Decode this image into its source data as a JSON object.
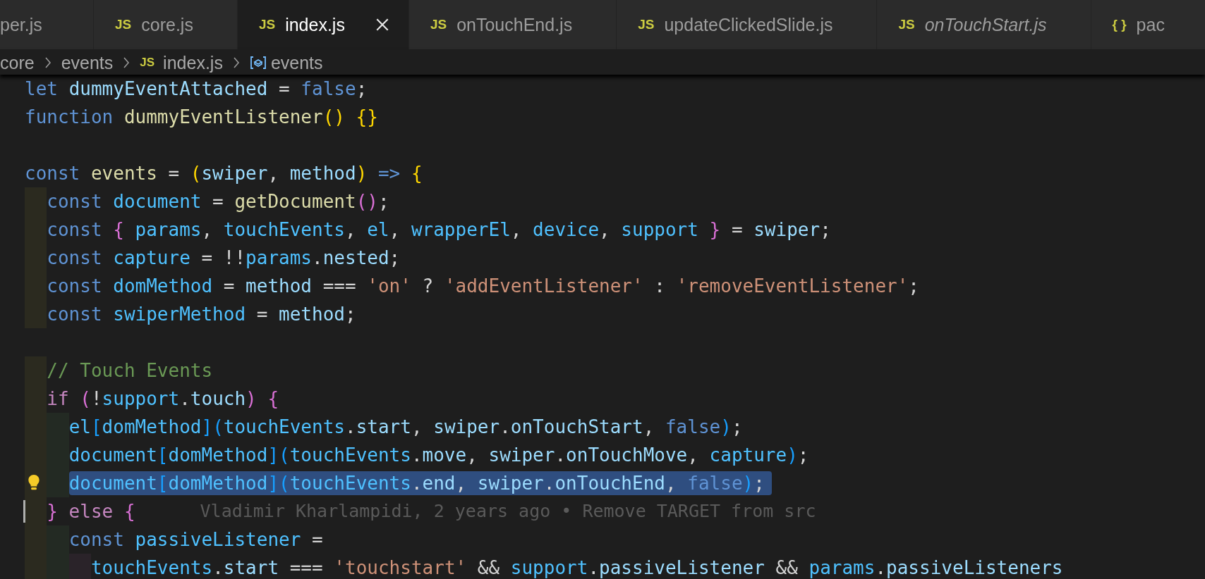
{
  "tabs": [
    {
      "label": "per.js",
      "selected": false,
      "preview": false
    },
    {
      "icon": "JS",
      "label": "core.js",
      "selected": false,
      "preview": false
    },
    {
      "icon": "JS",
      "label": "index.js",
      "selected": true,
      "preview": false
    },
    {
      "icon": "JS",
      "label": "onTouchEnd.js",
      "selected": false,
      "preview": false
    },
    {
      "icon": "JS",
      "label": "updateClickedSlide.js",
      "selected": false,
      "preview": false
    },
    {
      "icon": "JS",
      "label": "onTouchStart.js",
      "selected": false,
      "preview": true
    },
    {
      "icon": "{ }",
      "label": "pac",
      "selected": false,
      "preview": false
    }
  ],
  "breadcrumb": [
    {
      "kind": "folder",
      "label": "core"
    },
    {
      "kind": "folder",
      "label": "events"
    },
    {
      "kind": "file",
      "icon": "JS",
      "label": "index.js"
    },
    {
      "kind": "symbol",
      "label": "events"
    }
  ],
  "code_lines": [
    {
      "kind": "code",
      "tokens": [
        {
          "text": "let ",
          "kind": "keyword"
        },
        {
          "text": "dummyEventAttached",
          "kind": "param"
        },
        {
          "text": " = ",
          "kind": "plain"
        },
        {
          "text": "false",
          "kind": "keyword"
        },
        {
          "text": ";",
          "kind": "plain"
        }
      ]
    },
    {
      "kind": "code",
      "tokens": [
        {
          "text": "function ",
          "kind": "keyword"
        },
        {
          "text": "dummyEventListener",
          "kind": "function"
        },
        {
          "text": "() {}",
          "kind": "bracket1"
        }
      ]
    },
    {
      "kind": "blank"
    },
    {
      "kind": "code",
      "tokens": [
        {
          "text": "const ",
          "kind": "keyword"
        },
        {
          "text": "events",
          "kind": "function"
        },
        {
          "text": " = ",
          "kind": "plain"
        },
        {
          "text": "(",
          "kind": "bracket1"
        },
        {
          "text": "swiper",
          "kind": "param"
        },
        {
          "text": ", ",
          "kind": "plain"
        },
        {
          "text": "method",
          "kind": "param"
        },
        {
          "text": ")",
          "kind": "bracket1"
        },
        {
          "text": " => ",
          "kind": "keyword"
        },
        {
          "text": "{",
          "kind": "bracket1"
        }
      ]
    },
    {
      "kind": "code",
      "tokens": [
        {
          "text": "  const ",
          "kind": "keyword"
        },
        {
          "text": "document",
          "kind": "constant"
        },
        {
          "text": " = ",
          "kind": "plain"
        },
        {
          "text": "getDocument",
          "kind": "function"
        },
        {
          "text": "()",
          "kind": "bracket2"
        },
        {
          "text": ";",
          "kind": "plain"
        }
      ]
    },
    {
      "kind": "code",
      "tokens": [
        {
          "text": "  const ",
          "kind": "keyword"
        },
        {
          "text": "{ ",
          "kind": "bracket2"
        },
        {
          "text": "params",
          "kind": "constant"
        },
        {
          "text": ", ",
          "kind": "plain"
        },
        {
          "text": "touchEvents",
          "kind": "constant"
        },
        {
          "text": ", ",
          "kind": "plain"
        },
        {
          "text": "el",
          "kind": "constant"
        },
        {
          "text": ", ",
          "kind": "plain"
        },
        {
          "text": "wrapperEl",
          "kind": "constant"
        },
        {
          "text": ", ",
          "kind": "plain"
        },
        {
          "text": "device",
          "kind": "constant"
        },
        {
          "text": ", ",
          "kind": "plain"
        },
        {
          "text": "support",
          "kind": "constant"
        },
        {
          "text": " }",
          "kind": "bracket2"
        },
        {
          "text": " = ",
          "kind": "plain"
        },
        {
          "text": "swiper",
          "kind": "param"
        },
        {
          "text": ";",
          "kind": "plain"
        }
      ]
    },
    {
      "kind": "code",
      "tokens": [
        {
          "text": "  const ",
          "kind": "keyword"
        },
        {
          "text": "capture",
          "kind": "constant"
        },
        {
          "text": " = !!",
          "kind": "plain"
        },
        {
          "text": "params",
          "kind": "constant"
        },
        {
          "text": ".",
          "kind": "plain"
        },
        {
          "text": "nested",
          "kind": "param"
        },
        {
          "text": ";",
          "kind": "plain"
        }
      ]
    },
    {
      "kind": "code",
      "tokens": [
        {
          "text": "  const ",
          "kind": "keyword"
        },
        {
          "text": "domMethod",
          "kind": "constant"
        },
        {
          "text": " = ",
          "kind": "plain"
        },
        {
          "text": "method",
          "kind": "param"
        },
        {
          "text": " === ",
          "kind": "plain"
        },
        {
          "text": "'on'",
          "kind": "string"
        },
        {
          "text": " ? ",
          "kind": "plain"
        },
        {
          "text": "'addEventListener'",
          "kind": "string"
        },
        {
          "text": " : ",
          "kind": "plain"
        },
        {
          "text": "'removeEventListener'",
          "kind": "string"
        },
        {
          "text": ";",
          "kind": "plain"
        }
      ]
    },
    {
      "kind": "code",
      "tokens": [
        {
          "text": "  const ",
          "kind": "keyword"
        },
        {
          "text": "swiperMethod",
          "kind": "constant"
        },
        {
          "text": " = ",
          "kind": "plain"
        },
        {
          "text": "method",
          "kind": "param"
        },
        {
          "text": ";",
          "kind": "plain"
        }
      ]
    },
    {
      "kind": "blank"
    },
    {
      "kind": "code",
      "tokens": [
        {
          "text": "  // Touch Events",
          "kind": "comment"
        }
      ]
    },
    {
      "kind": "code",
      "tokens": [
        {
          "text": "  if ",
          "kind": "control"
        },
        {
          "text": "(",
          "kind": "bracket2"
        },
        {
          "text": "!",
          "kind": "plain"
        },
        {
          "text": "support",
          "kind": "constant"
        },
        {
          "text": ".",
          "kind": "plain"
        },
        {
          "text": "touch",
          "kind": "param"
        },
        {
          "text": ") {",
          "kind": "bracket2"
        }
      ]
    },
    {
      "kind": "code",
      "tokens": [
        {
          "text": "    el",
          "kind": "constant"
        },
        {
          "text": "[",
          "kind": "bracket3"
        },
        {
          "text": "domMethod",
          "kind": "constant"
        },
        {
          "text": "](",
          "kind": "bracket3"
        },
        {
          "text": "touchEvents",
          "kind": "constant"
        },
        {
          "text": ".",
          "kind": "plain"
        },
        {
          "text": "start",
          "kind": "param"
        },
        {
          "text": ", ",
          "kind": "plain"
        },
        {
          "text": "swiper",
          "kind": "param"
        },
        {
          "text": ".",
          "kind": "plain"
        },
        {
          "text": "onTouchStart",
          "kind": "param"
        },
        {
          "text": ", ",
          "kind": "plain"
        },
        {
          "text": "false",
          "kind": "keyword"
        },
        {
          "text": ")",
          "kind": "bracket3"
        },
        {
          "text": ";",
          "kind": "plain"
        }
      ]
    },
    {
      "kind": "code",
      "tokens": [
        {
          "text": "    document",
          "kind": "constant"
        },
        {
          "text": "[",
          "kind": "bracket3"
        },
        {
          "text": "domMethod",
          "kind": "constant"
        },
        {
          "text": "](",
          "kind": "bracket3"
        },
        {
          "text": "touchEvents",
          "kind": "constant"
        },
        {
          "text": ".",
          "kind": "plain"
        },
        {
          "text": "move",
          "kind": "param"
        },
        {
          "text": ", ",
          "kind": "plain"
        },
        {
          "text": "swiper",
          "kind": "param"
        },
        {
          "text": ".",
          "kind": "plain"
        },
        {
          "text": "onTouchMove",
          "kind": "param"
        },
        {
          "text": ", ",
          "kind": "plain"
        },
        {
          "text": "capture",
          "kind": "constant"
        },
        {
          "text": ")",
          "kind": "bracket3"
        },
        {
          "text": ";",
          "kind": "plain"
        }
      ]
    },
    {
      "kind": "code",
      "selected": true,
      "lightbulb": true,
      "tokens": [
        {
          "text": "    document",
          "kind": "constant"
        },
        {
          "text": "[",
          "kind": "bracket3"
        },
        {
          "text": "domMethod",
          "kind": "constant"
        },
        {
          "text": "](",
          "kind": "bracket3"
        },
        {
          "text": "touchEvents",
          "kind": "constant"
        },
        {
          "text": ".",
          "kind": "plain"
        },
        {
          "text": "end",
          "kind": "param"
        },
        {
          "text": ", ",
          "kind": "plain"
        },
        {
          "text": "swiper",
          "kind": "param"
        },
        {
          "text": ".",
          "kind": "plain"
        },
        {
          "text": "onTouchEnd",
          "kind": "param"
        },
        {
          "text": ", ",
          "kind": "plain"
        },
        {
          "text": "false",
          "kind": "keyword"
        },
        {
          "text": ")",
          "kind": "bracket3"
        },
        {
          "text": ";",
          "kind": "plain"
        }
      ]
    },
    {
      "kind": "code",
      "cursor": true,
      "annotation": "Vladimir Kharlampidi, 2 years ago • Remove TARGET from src",
      "tokens": [
        {
          "text": "  }",
          "kind": "bracket2"
        },
        {
          "text": " else ",
          "kind": "control"
        },
        {
          "text": "{",
          "kind": "bracket2"
        }
      ]
    },
    {
      "kind": "code",
      "tokens": [
        {
          "text": "    const ",
          "kind": "keyword"
        },
        {
          "text": "passiveListener",
          "kind": "constant"
        },
        {
          "text": " =",
          "kind": "plain"
        }
      ]
    },
    {
      "kind": "code",
      "tokens": [
        {
          "text": "      touchEvents",
          "kind": "constant"
        },
        {
          "text": ".",
          "kind": "plain"
        },
        {
          "text": "start",
          "kind": "param"
        },
        {
          "text": " === ",
          "kind": "plain"
        },
        {
          "text": "'touchstart'",
          "kind": "string"
        },
        {
          "text": " && ",
          "kind": "plain"
        },
        {
          "text": "support",
          "kind": "constant"
        },
        {
          "text": ".",
          "kind": "plain"
        },
        {
          "text": "passiveListener",
          "kind": "param"
        },
        {
          "text": " && ",
          "kind": "plain"
        },
        {
          "text": "params",
          "kind": "constant"
        },
        {
          "text": ".",
          "kind": "plain"
        },
        {
          "text": "passiveListeners",
          "kind": "param"
        }
      ]
    }
  ]
}
